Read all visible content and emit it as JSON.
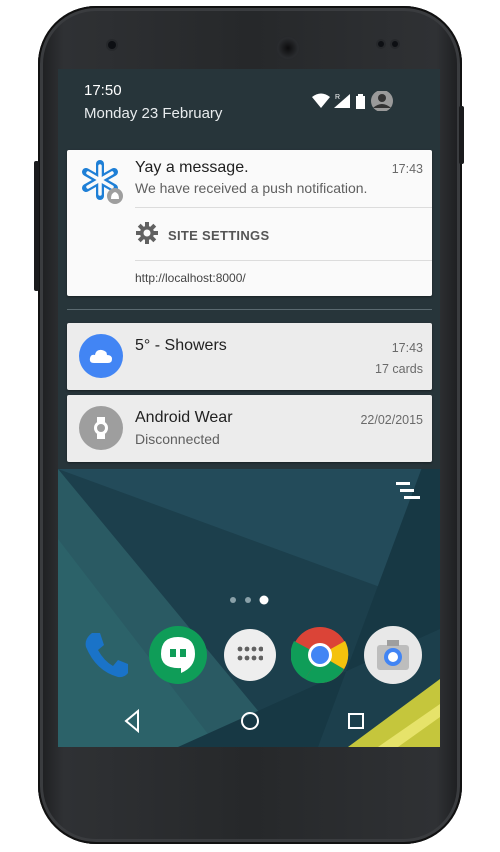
{
  "status_bar": {
    "time": "17:50",
    "date": "Monday 23 February"
  },
  "notifications": [
    {
      "title": "Yay a message.",
      "body": "We have received a push notification.",
      "time": "17:43",
      "action_label": "SITE SETTINGS",
      "url": "http://localhost:8000/"
    },
    {
      "title": "5° - Showers",
      "time": "17:43",
      "detail": "17 cards",
      "accent": "#4285f4"
    },
    {
      "title": "Android Wear",
      "body": "Disconnected",
      "time": "22/02/2015"
    }
  ],
  "colors": {
    "shade": "#283438",
    "card": "#fafafa",
    "card_grey": "#ececec",
    "brand_blue": "#1e7fd6"
  },
  "home": {
    "page_indicator_count": 3,
    "active_page": 3
  },
  "icons": {
    "dock": [
      "phone-icon",
      "hangouts-icon",
      "app-drawer-icon",
      "chrome-icon",
      "camera-icon"
    ],
    "nav": [
      "back-icon",
      "home-icon",
      "recents-icon"
    ]
  }
}
